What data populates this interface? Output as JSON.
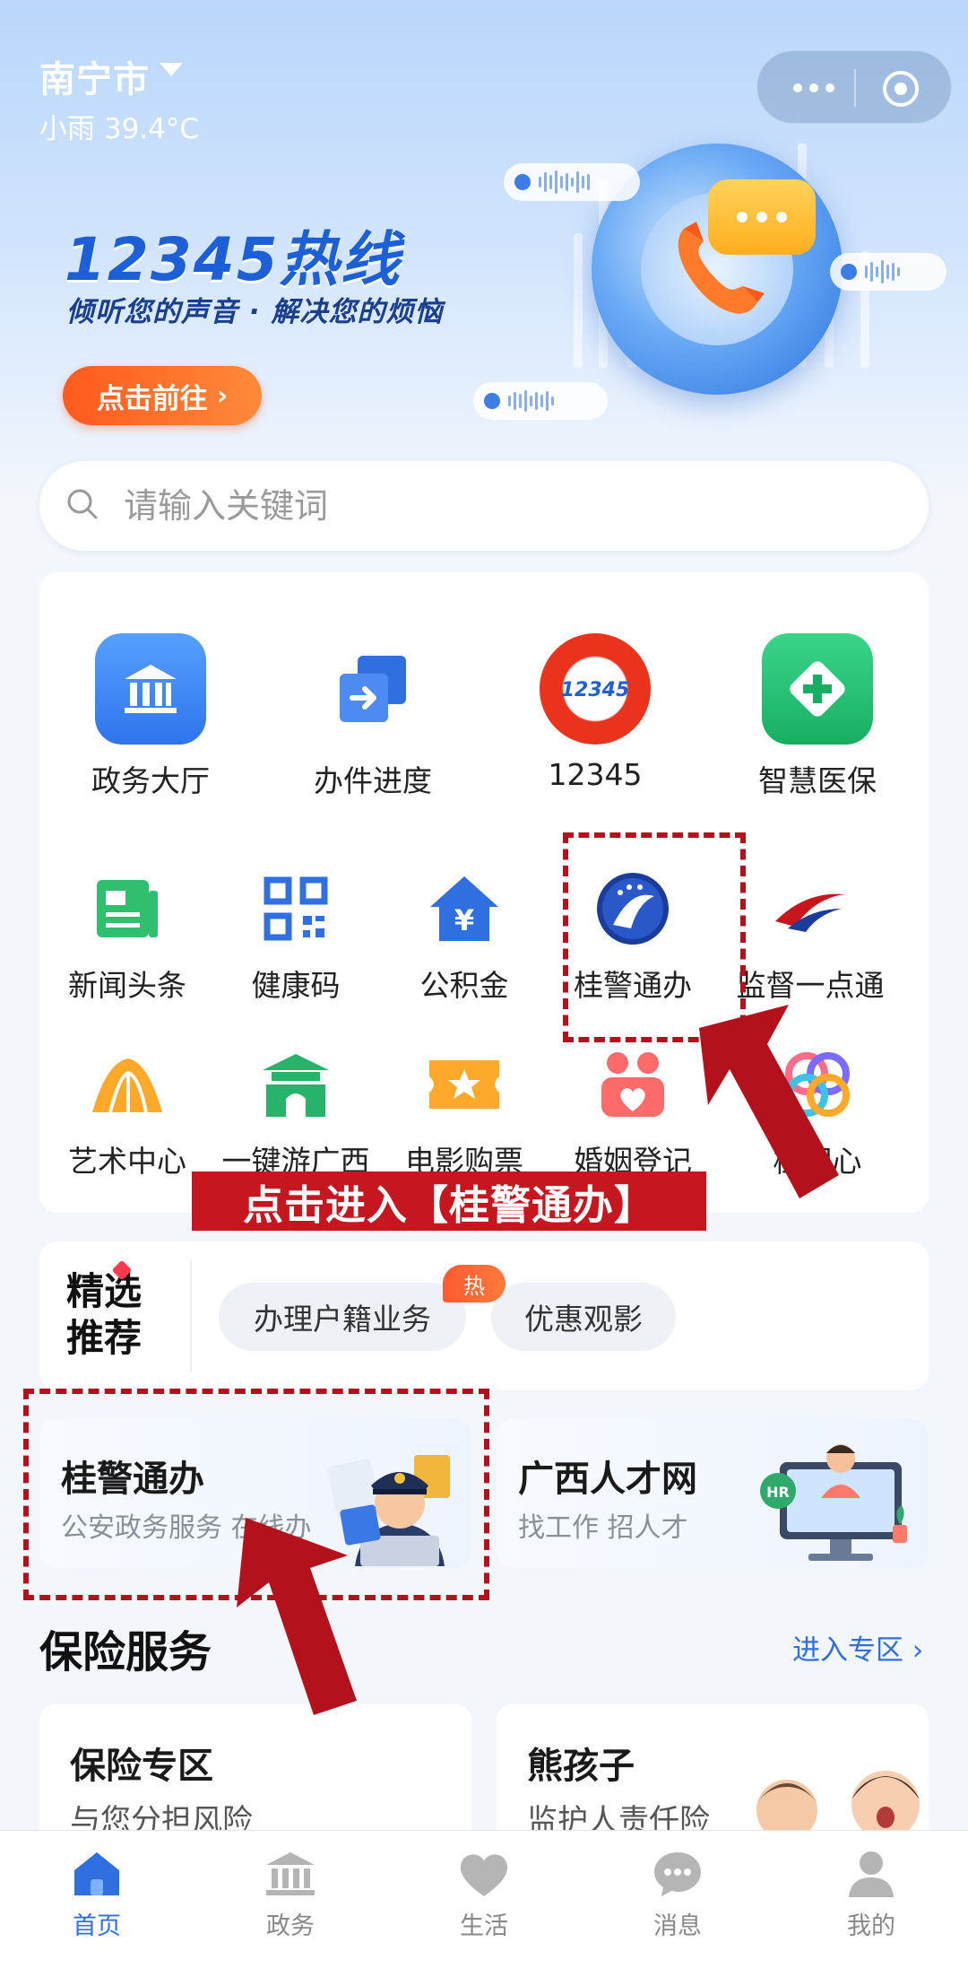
{
  "header": {
    "city": "南宁市",
    "weather": "小雨 39.4°C"
  },
  "banner": {
    "title": "12345热线",
    "subtitle": "倾听您的声音 · 解决您的烦恼",
    "button_label": "点击前往",
    "button_chevron": "›"
  },
  "search": {
    "placeholder": "请输入关键词"
  },
  "services_row1": [
    {
      "label": "政务大厅",
      "icon": "bank-icon",
      "color": "#3d86f5"
    },
    {
      "label": "办件进度",
      "icon": "progress-icon",
      "color": "#3170e8"
    },
    {
      "label": "12345",
      "icon": "hotline-12345-icon",
      "color": "#e8341c"
    },
    {
      "label": "智慧医保",
      "icon": "medical-insurance-icon",
      "color": "#27c377"
    }
  ],
  "services_row2": [
    {
      "label": "新闻头条",
      "icon": "news-icon"
    },
    {
      "label": "健康码",
      "icon": "qr-code-icon"
    },
    {
      "label": "公积金",
      "icon": "housing-fund-icon"
    },
    {
      "label": "桂警通办",
      "icon": "gui-police-icon"
    },
    {
      "label": "监督一点通",
      "icon": "supervision-icon"
    }
  ],
  "services_row3": [
    {
      "label": "艺术中心",
      "icon": "art-center-icon"
    },
    {
      "label": "一键游广西",
      "icon": "travel-guangxi-icon"
    },
    {
      "label": "电影购票",
      "icon": "movie-ticket-icon"
    },
    {
      "label": "婚姻登记",
      "icon": "marriage-icon"
    },
    {
      "label": "桂同心",
      "icon": "gui-tongxin-icon"
    }
  ],
  "annotation": {
    "callout": "点击进入【桂警通办】"
  },
  "recommend": {
    "title_line1": "精选",
    "title_line2": "推荐",
    "chips": [
      "办理户籍业务",
      "优惠观影"
    ],
    "hot_badge": "热"
  },
  "features": [
    {
      "title": "桂警通办",
      "subtitle": "公安政务服务 在线办"
    },
    {
      "title": "广西人才网",
      "subtitle": "找工作 招人才"
    }
  ],
  "insurance": {
    "section_title": "保险服务",
    "link_label": "进入专区",
    "link_chevron": "›",
    "cards": [
      {
        "title": "保险专区",
        "subtitle": "与您分担风险"
      },
      {
        "title": "熊孩子",
        "subtitle": "监护人责任险"
      }
    ]
  },
  "tabbar": {
    "active_color": "#2f6fe0",
    "inactive_color": "#b5b5b5",
    "tabs": [
      {
        "label": "首页",
        "icon": "home-icon",
        "active": true
      },
      {
        "label": "政务",
        "icon": "government-icon",
        "active": false
      },
      {
        "label": "生活",
        "icon": "heart-icon",
        "active": false
      },
      {
        "label": "消息",
        "icon": "message-icon",
        "active": false
      },
      {
        "label": "我的",
        "icon": "profile-icon",
        "active": false
      }
    ]
  }
}
